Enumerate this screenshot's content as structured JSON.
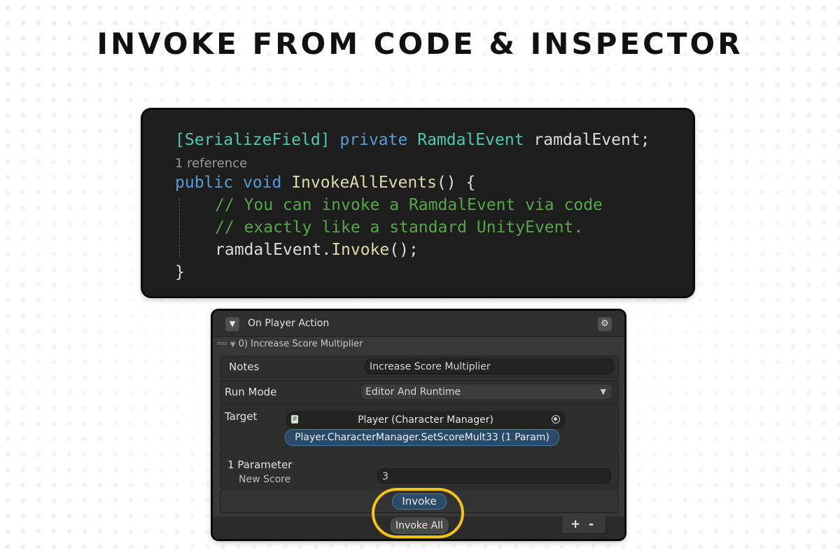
{
  "title": "INVOKE FROM CODE & INSPECTOR",
  "code": {
    "line1": {
      "attr": "[SerializeField]",
      "kw": "private",
      "type": "RamdalEvent",
      "name": "ramdalEvent;"
    },
    "reference": "1 reference",
    "line3": {
      "kw1": "public",
      "kw2": "void",
      "method": "InvokeAllEvents",
      "rest": "() {"
    },
    "comment1": "// You can invoke a RamdalEvent via code",
    "comment2": "// exactly like a standard UnityEvent.",
    "line6": {
      "ident": "ramdalEvent",
      "dot": ".",
      "method": "Invoke",
      "rest": "();"
    },
    "close": "}"
  },
  "inspector": {
    "header_title": "On Player Action",
    "entry_title": "0) Increase Score Multiplier",
    "notes_label": "Notes",
    "notes_value": "Increase Score Multiplier",
    "run_mode_label": "Run Mode",
    "run_mode_value": "Editor And Runtime",
    "target_label": "Target",
    "target_object": "Player (Character Manager)",
    "target_method": "Player.CharacterManager.SetScoreMult33 (1 Param)",
    "param_header": "1 Parameter",
    "param_name": "New Score",
    "param_value": "3",
    "invoke_label": "Invoke",
    "invoke_all_label": "Invoke All",
    "plus": "+",
    "minus": "-"
  },
  "colors": {
    "keyword": "#569cd6",
    "type": "#4ec9b0",
    "method": "#dcdcaa",
    "comment": "#57a64a",
    "highlight": "#f2c21b",
    "button_blue": "#2a4a68"
  },
  "icons": {
    "fold": "triangle-down-icon",
    "settings": "gear-icon",
    "script": "csharp-script-icon",
    "picker": "object-picker-icon",
    "dropdown": "chevron-down-icon"
  }
}
